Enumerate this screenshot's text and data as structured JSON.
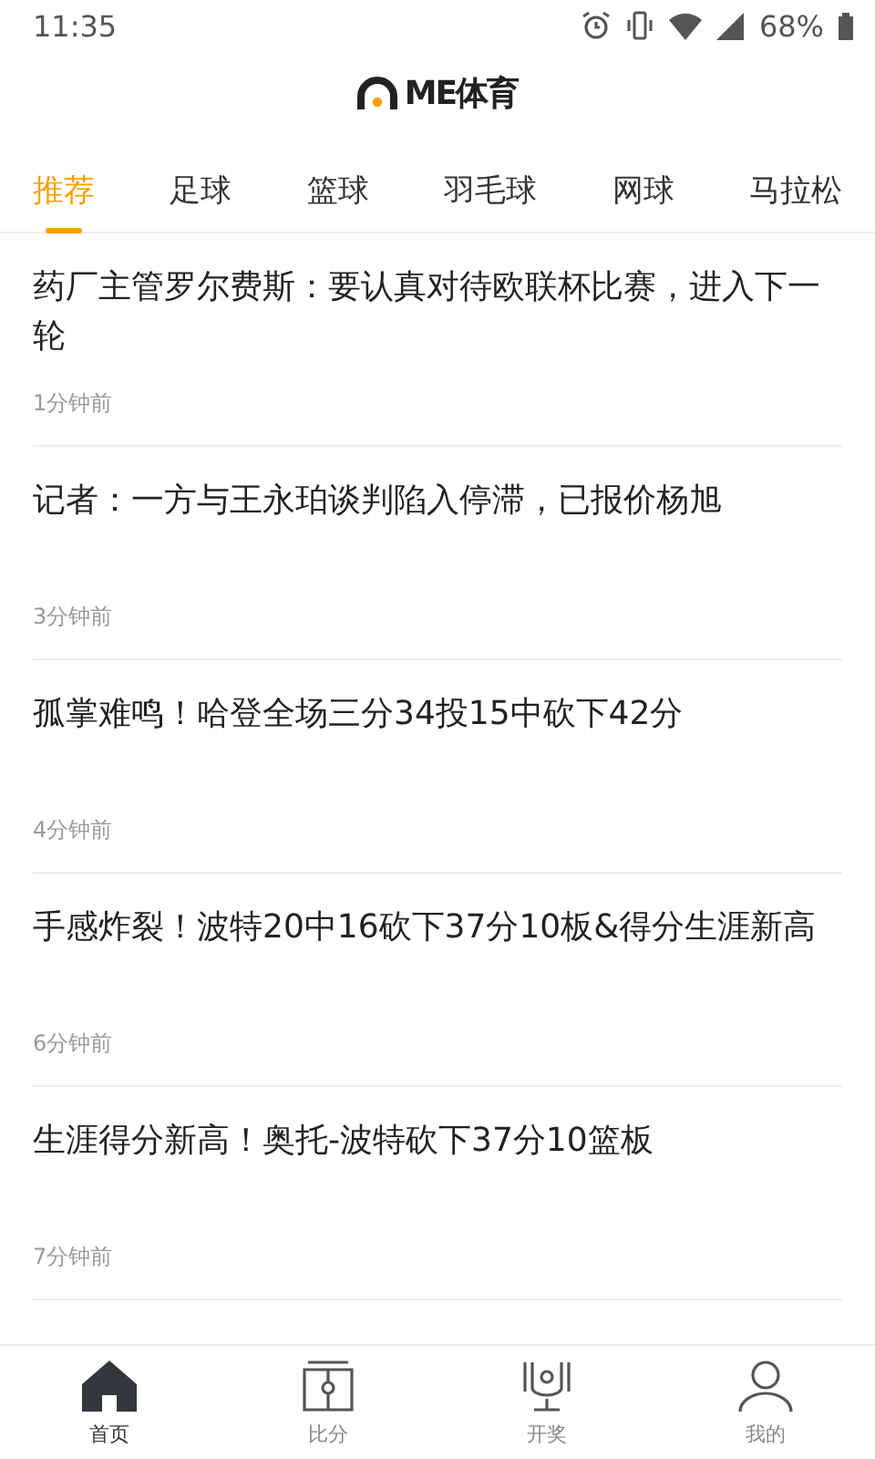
{
  "status_bar": {
    "time": "11:35",
    "battery": "68%"
  },
  "logo": {
    "text": "ME体育"
  },
  "tabs": [
    {
      "label": "推荐",
      "selected": true
    },
    {
      "label": "足球",
      "selected": false
    },
    {
      "label": "篮球",
      "selected": false
    },
    {
      "label": "羽毛球",
      "selected": false
    },
    {
      "label": "网球",
      "selected": false
    },
    {
      "label": "马拉松",
      "selected": false
    }
  ],
  "news": [
    {
      "title": "药厂主管罗尔费斯：要认真对待欧联杯比赛，进入下一轮",
      "time": "1分钟前"
    },
    {
      "title": "记者：一方与王永珀谈判陷入停滞，已报价杨旭",
      "time": "3分钟前"
    },
    {
      "title": "孤掌难鸣！哈登全场三分34投15中砍下42分",
      "time": "4分钟前"
    },
    {
      "title": "手感炸裂！波特20中16砍下37分10板&得分生涯新高",
      "time": "6分钟前"
    },
    {
      "title": "生涯得分新高！奥托-波特砍下37分10篮板",
      "time": "7分钟前"
    }
  ],
  "bottom_nav": [
    {
      "kind": "home",
      "label": "首页",
      "selected": true
    },
    {
      "kind": "score",
      "label": "比分",
      "selected": false
    },
    {
      "kind": "lottery",
      "label": "开奖",
      "selected": false
    },
    {
      "kind": "profile",
      "label": "我的",
      "selected": false
    }
  ]
}
